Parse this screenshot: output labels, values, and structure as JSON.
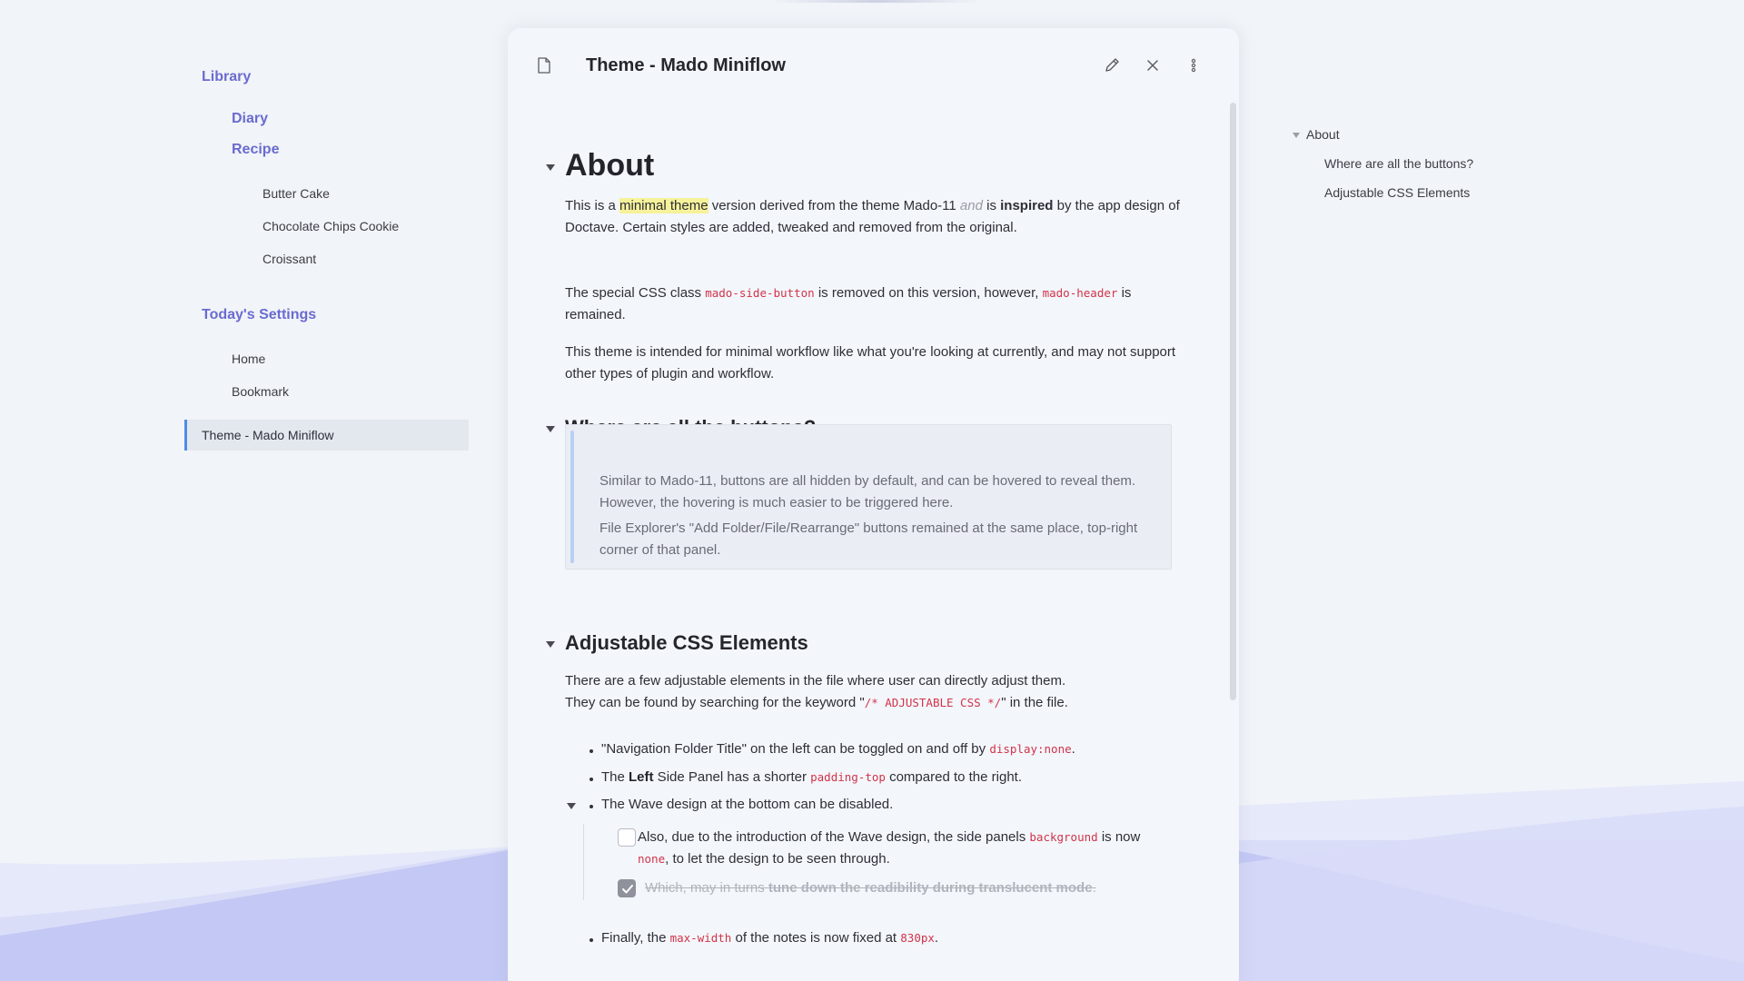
{
  "sidebar": {
    "library": "Library",
    "diary": "Diary",
    "recipe": "Recipe",
    "recipes": [
      "Butter Cake",
      "Chocolate Chips Cookie",
      "Croissant"
    ],
    "todays_settings": "Today's Settings",
    "home": "Home",
    "bookmark": "Bookmark",
    "active": "Theme - Mado Miniflow"
  },
  "note": {
    "title": "Theme - Mado Miniflow",
    "icons": {
      "file": "file-icon",
      "edit": "pencil-icon",
      "close": "close-icon",
      "more": "more-vertical-icon"
    },
    "about": {
      "heading": "About",
      "p1": {
        "t1": "This is a ",
        "highlight": "minimal theme",
        "t2": " version derived from the theme Mado-11 ",
        "italic": "and",
        "t3": " is ",
        "bold": "inspired",
        "t4": " by the app design of Doctave. Certain styles are added, tweaked and removed from the original."
      },
      "p2": {
        "t1": "The special CSS class ",
        "code1": "mado-side-button",
        "t2": " is removed on this version, however, ",
        "code2": "mado-header",
        "t3": " is remained."
      },
      "p3": "This theme is intended for minimal workflow like what you're looking at currently, and may not support other types of plugin and workflow."
    },
    "buttons": {
      "heading": "Where are all the buttons?",
      "quote1": "Similar to Mado-11, buttons are all hidden by default, and can be hovered to reveal them. However, the hovering is much easier to be triggered here.",
      "quote2": "File Explorer's \"Add Folder/File/Rearrange\" buttons remained at the same place, top-right corner of that panel."
    },
    "adjustable": {
      "heading": "Adjustable CSS Elements",
      "line1": "There are a few adjustable elements in the file where user can directly adjust them.",
      "line2_pre": "They can be found by searching for the keyword \"",
      "line2_code": "/* ADJUSTABLE CSS */",
      "line2_post": "\" in the file.",
      "b1_pre": "\"Navigation Folder Title\" on the left can be toggled on and off by ",
      "b1_code": "display:none",
      "b1_post": ".",
      "b2_pre": "The ",
      "b2_bold": "Left",
      "b2_mid": " Side Panel has a shorter ",
      "b2_code": "padding-top",
      "b2_post": " compared to the right.",
      "b3": "The Wave design at the bottom can be disabled.",
      "task1_pre": "Also, due to the introduction of the Wave design, the side panels ",
      "task1_code1": "background",
      "task1_mid": " is now ",
      "task1_code2": "none",
      "task1_post": ", to let the design to be seen through.",
      "task1_checked": false,
      "task2_pre": "Which, may in turns ",
      "task2_bold": "tune down the readibility during translucent mode",
      "task2_post": ".",
      "task2_checked": true,
      "b4_pre": "Finally, the ",
      "b4_code1": "max-width",
      "b4_mid": " of the notes is now fixed at ",
      "b4_code2": "830px",
      "b4_post": "."
    }
  },
  "outline": {
    "items": [
      "About",
      "Where are all the buttons?",
      "Adjustable CSS Elements"
    ]
  },
  "colors": {
    "accent": "#6a6bd0",
    "active_bar": "#4d8de6",
    "code": "#d2334a",
    "highlight": "#f6f29a",
    "wave": "#c3c8f4"
  }
}
